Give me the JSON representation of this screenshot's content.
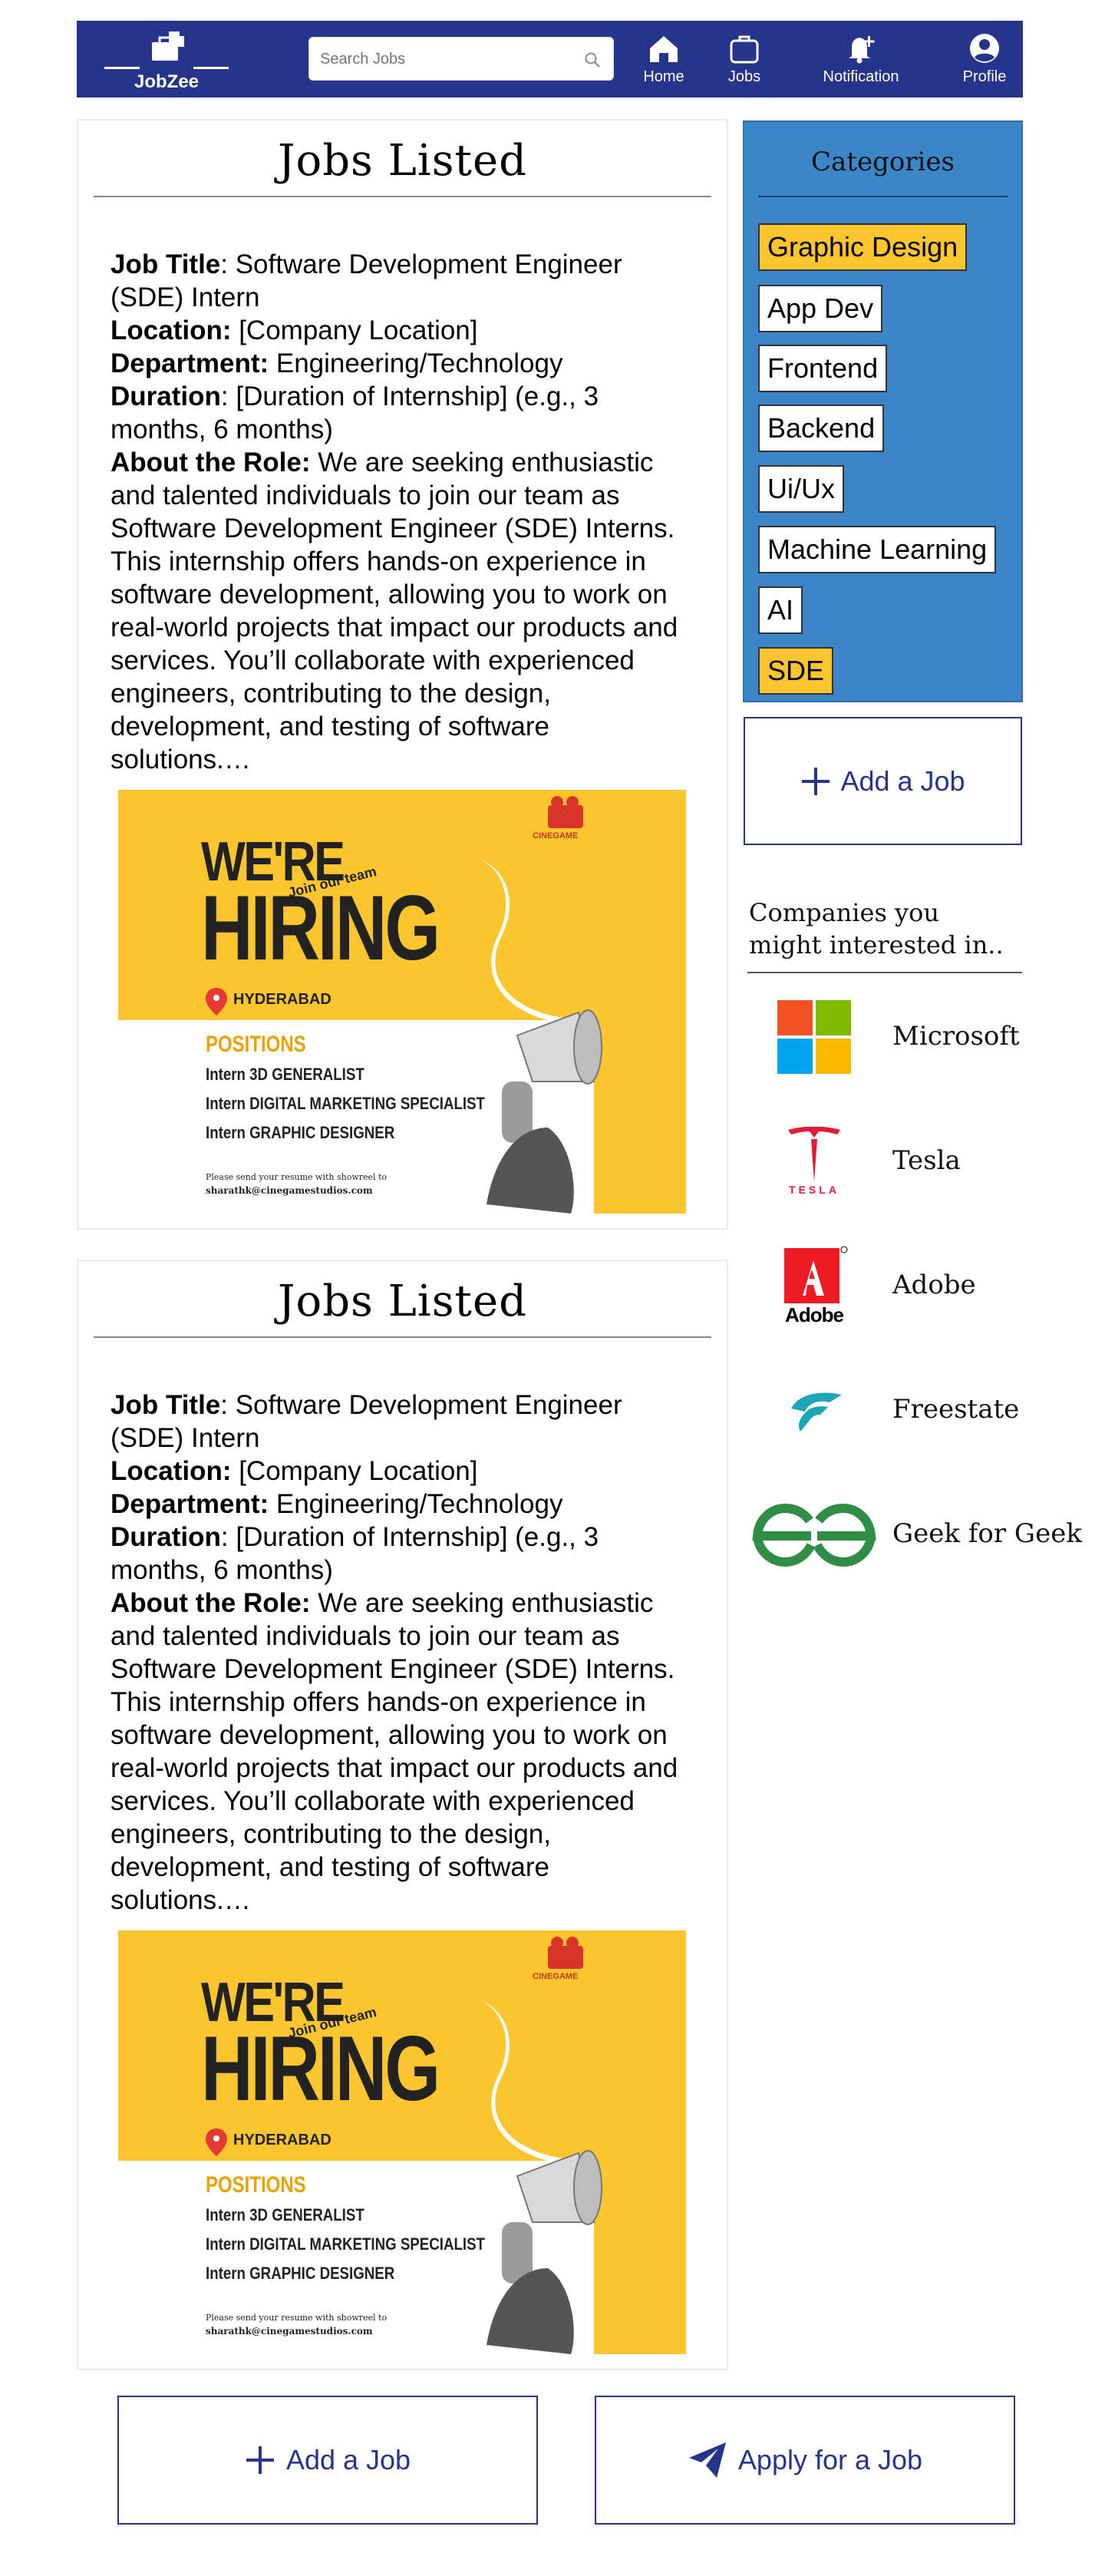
{
  "nav": {
    "brand": "JobZee",
    "search_placeholder": "Search Jobs",
    "items": [
      {
        "label": "Home",
        "icon": "home-icon"
      },
      {
        "label": "Jobs",
        "icon": "briefcase-icon"
      },
      {
        "label": "Notification",
        "icon": "bell-plus-icon"
      },
      {
        "label": "Profile",
        "icon": "user-circle-icon"
      }
    ]
  },
  "jobs": [
    {
      "heading": "Jobs Listed",
      "title_label": "Job Title",
      "title_value": ": Software Development Engineer (SDE) Intern",
      "location_label": "Location:",
      "location_value": " [Company Location]",
      "department_label": "Department:",
      "department_value": " Engineering/Technology",
      "duration_label": "Duration",
      "duration_value": ": [Duration of Internship] (e.g., 3 months, 6 months)",
      "about_label": "About the Role:",
      "about_value": " We are seeking enthusiastic and talented individuals to join our team as Software Development Engineer (SDE) Interns. This internship offers hands-on experience in software development, allowing you to work on real-world projects that impact our products and services. You’ll collaborate with experienced engineers, contributing to the design, development, and testing of software solutions.…",
      "poster": {
        "studio": "CINEGAME",
        "line1": "WE'RE",
        "tag": "Join our team",
        "line2": "HIRING",
        "city": "HYDERABAD",
        "positions_heading": "POSITIONS",
        "positions": [
          "Intern 3D GENERALIST",
          "Intern DIGITAL MARKETING SPECIALIST",
          "Intern GRAPHIC DESIGNER"
        ],
        "footer1": "Please send your resume with showreel to",
        "footer2": "sharathk@cinegamestudios.com"
      }
    },
    {
      "heading": "Jobs Listed",
      "title_label": "Job Title",
      "title_value": ": Software Development Engineer (SDE) Intern",
      "location_label": "Location:",
      "location_value": " [Company Location]",
      "department_label": "Department:",
      "department_value": " Engineering/Technology",
      "duration_label": "Duration",
      "duration_value": ": [Duration of Internship] (e.g., 3 months, 6 months)",
      "about_label": "About the Role:",
      "about_value": " We are seeking enthusiastic and talented individuals to join our team as Software Development Engineer (SDE) Interns. This internship offers hands-on experience in software development, allowing you to work on real-world projects that impact our products and services. You’ll collaborate with experienced engineers, contributing to the design, development, and testing of software solutions.…",
      "poster": {
        "studio": "CINEGAME",
        "line1": "WE'RE",
        "tag": "Join our team",
        "line2": "HIRING",
        "city": "HYDERABAD",
        "positions_heading": "POSITIONS",
        "positions": [
          "Intern 3D GENERALIST",
          "Intern DIGITAL MARKETING SPECIALIST",
          "Intern GRAPHIC DESIGNER"
        ],
        "footer1": "Please send your resume with showreel to",
        "footer2": "sharathk@cinegamestudios.com"
      }
    }
  ],
  "categories": {
    "title": "Categories",
    "items": [
      {
        "label": "Graphic Design",
        "highlighted": true
      },
      {
        "label": "App Dev",
        "highlighted": false
      },
      {
        "label": "Frontend",
        "highlighted": false
      },
      {
        "label": "Backend",
        "highlighted": false
      },
      {
        "label": "Ui/Ux",
        "highlighted": false
      },
      {
        "label": "Machine Learning",
        "highlighted": false
      },
      {
        "label": "AI",
        "highlighted": false
      },
      {
        "label": "SDE",
        "highlighted": true
      }
    ]
  },
  "sidebar": {
    "add_job_label": "Add a Job",
    "companies_title": "Companies you might interested in..",
    "companies": [
      {
        "name": "Microsoft",
        "logo": "microsoft-logo"
      },
      {
        "name": "Tesla",
        "logo": "tesla-logo",
        "logo_text": "TESLA"
      },
      {
        "name": "Adobe",
        "logo": "adobe-logo",
        "logo_text": "Adobe"
      },
      {
        "name": "Freestate",
        "logo": "freestate-logo"
      },
      {
        "name": "Geek for Geek",
        "logo": "geeksforgeeks-logo"
      }
    ]
  },
  "footer_actions": {
    "add_job_label": "Add a Job",
    "apply_label": "Apply for a Job"
  },
  "colors": {
    "nav_blue": "#27348b",
    "category_blue": "#3b86c8",
    "highlight_yellow": "#fbc52d"
  }
}
